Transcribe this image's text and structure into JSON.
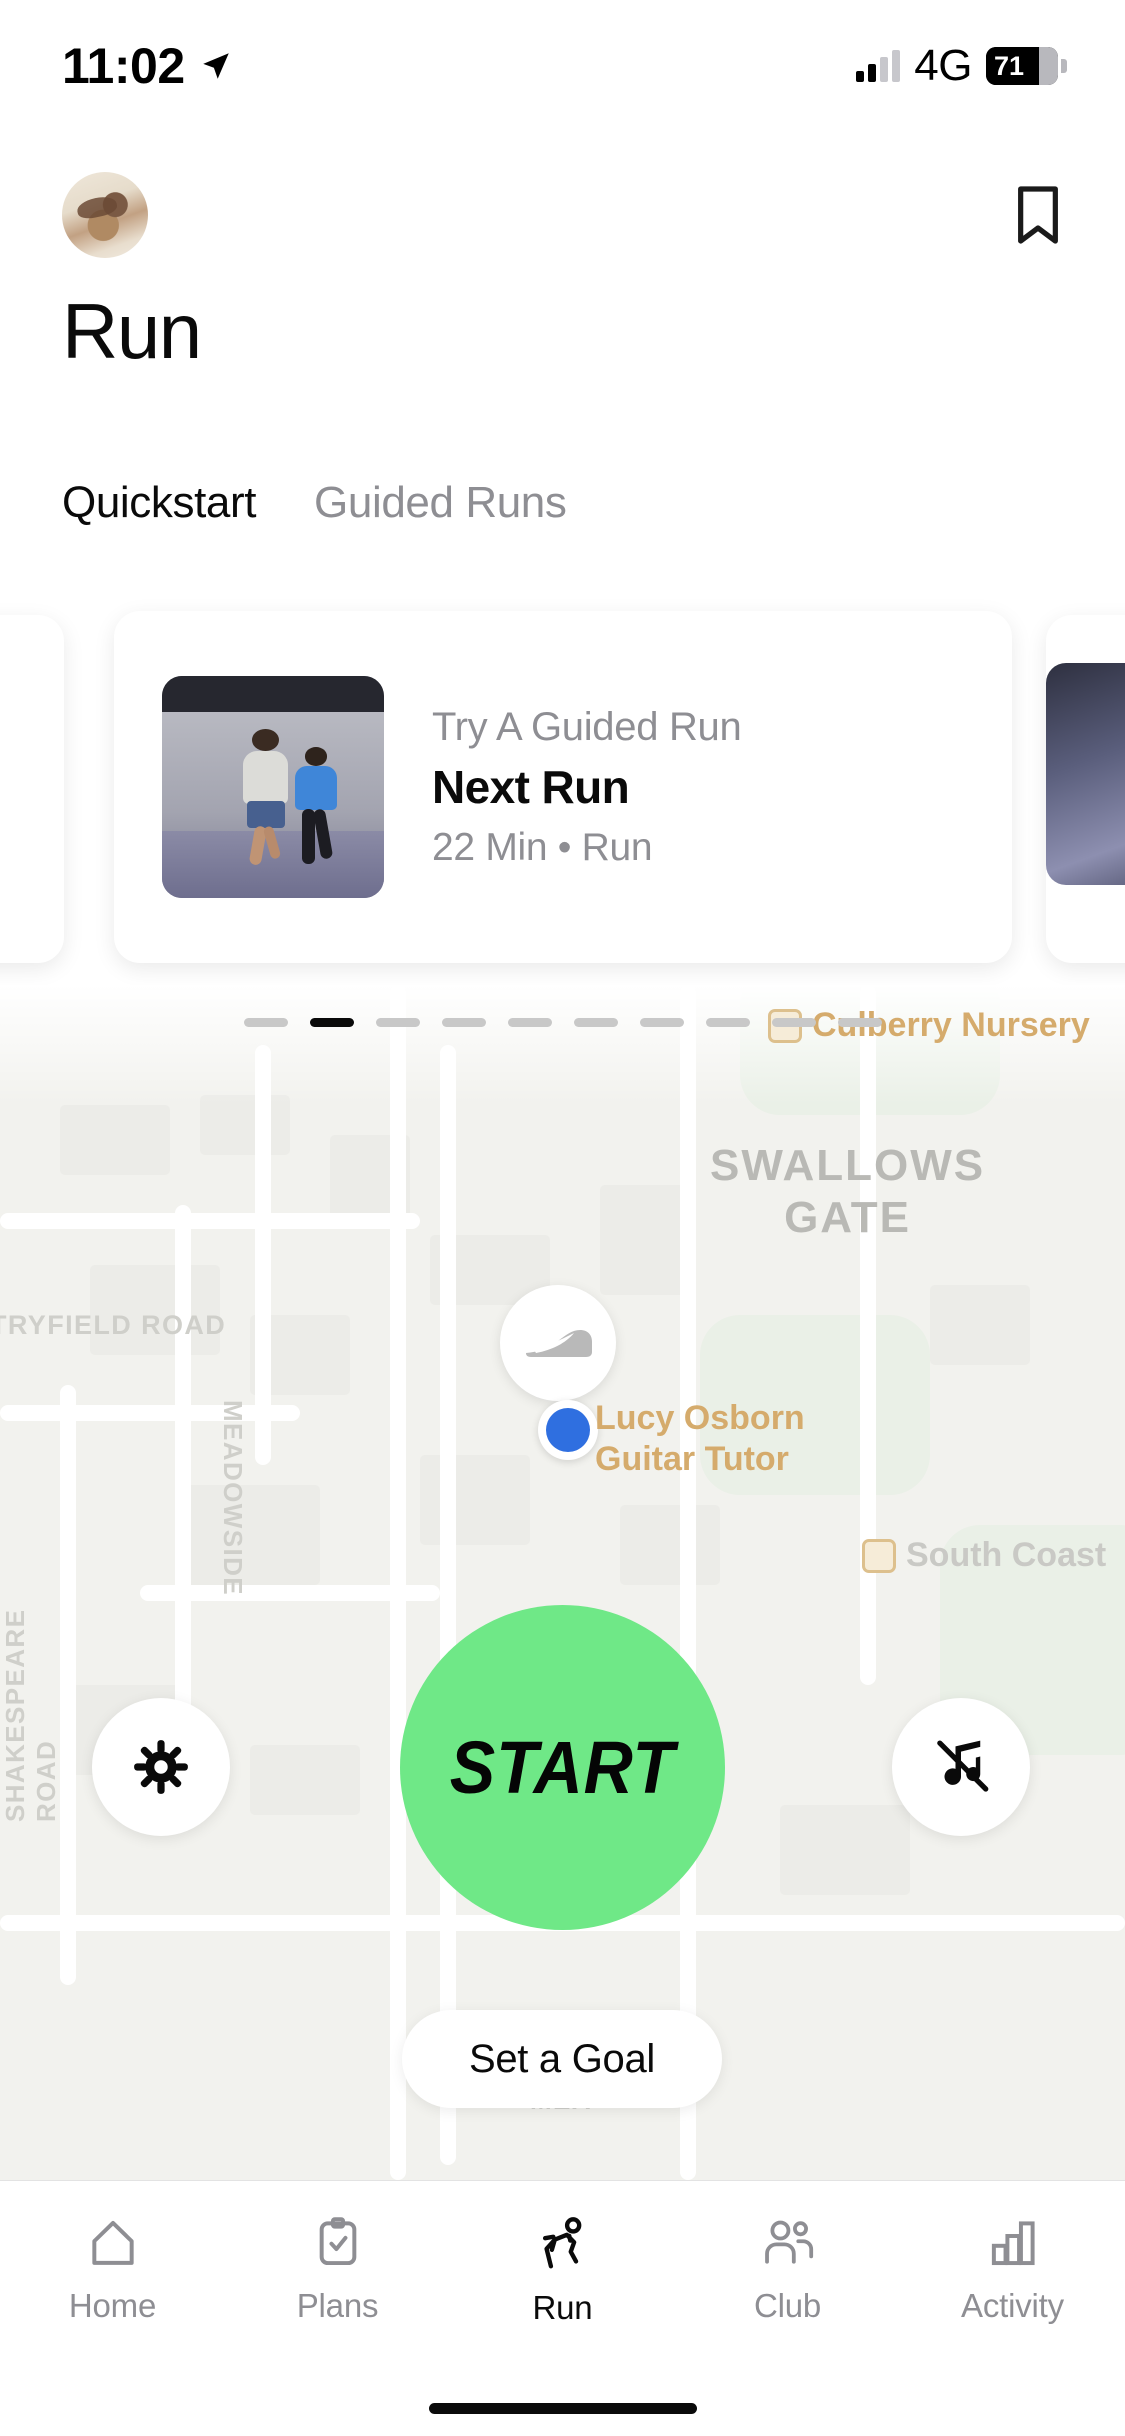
{
  "status_bar": {
    "time": "11:02",
    "location_icon": "location-arrow-icon",
    "network": "4G",
    "battery_percent": "71",
    "signal_icon": "signal-bars-icon"
  },
  "header": {
    "avatar": "user-avatar",
    "bookmark_icon": "bookmark-icon"
  },
  "page": {
    "title": "Run"
  },
  "tabs": [
    {
      "label": "Quickstart",
      "active": true
    },
    {
      "label": "Guided Runs",
      "active": false
    }
  ],
  "carousel": {
    "card": {
      "eyebrow": "Try A Guided Run",
      "title": "Next Run",
      "meta": "22 Min • Run",
      "thumbnail": "two-runners-photo"
    },
    "page_dots_total": 10,
    "page_dots_active_index": 1
  },
  "map": {
    "area_label": "SWALLOWS\nGATE",
    "area_label_line1": "SWALLOWS",
    "area_label_line2": "GATE",
    "streets": [
      "TRYFIELD ROAD",
      "MEADOWSIDE",
      "SHAKESPEARE ROAD",
      "MEA"
    ],
    "pois": [
      {
        "name": "Culberry Nursery",
        "icon": "poi-icon"
      },
      {
        "name": "Lucy Osborn",
        "subtitle": "Guitar Tutor",
        "icon": "location-dot"
      },
      {
        "name": "South Coast",
        "icon": "poi-icon"
      }
    ],
    "shoe_marker": "nike-shoe-marker",
    "current_location": "blue-location-dot",
    "colors": {
      "poi_gold": "#d5ab6c",
      "location_blue": "#2f6fe0",
      "background": "#f2f2ee"
    }
  },
  "controls": {
    "start_label": "START",
    "start_color": "#6fe887",
    "settings_icon": "gear-icon",
    "music_icon": "music-note-muted-icon",
    "goal_label": "Set a Goal"
  },
  "tabbar": [
    {
      "label": "Home",
      "icon": "home-icon",
      "active": false
    },
    {
      "label": "Plans",
      "icon": "clipboard-check-icon",
      "active": false
    },
    {
      "label": "Run",
      "icon": "running-person-icon",
      "active": true
    },
    {
      "label": "Club",
      "icon": "people-icon",
      "active": false
    },
    {
      "label": "Activity",
      "icon": "bar-chart-icon",
      "active": false
    }
  ]
}
